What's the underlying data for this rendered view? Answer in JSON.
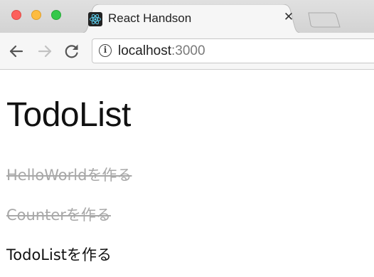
{
  "window": {
    "controls": [
      "close",
      "minimize",
      "maximize"
    ]
  },
  "tab": {
    "title": "React Handson",
    "favicon": "react-icon",
    "close_symbol": "✕"
  },
  "toolbar": {
    "back_icon": "back-arrow-icon",
    "forward_icon": "forward-arrow-icon",
    "reload_icon": "reload-icon",
    "info_symbol": "i",
    "url_host": "localhost",
    "url_port": ":3000"
  },
  "page": {
    "title": "TodoList",
    "todos": [
      {
        "text": "HelloWorldを作る",
        "completed": true
      },
      {
        "text": "Counterを作る",
        "completed": true
      },
      {
        "text": "TodoListを作る",
        "completed": false
      }
    ]
  },
  "colors": {
    "completed_text": "#a8a8a8",
    "pending_text": "#111111",
    "react_blue": "#61dafb"
  }
}
